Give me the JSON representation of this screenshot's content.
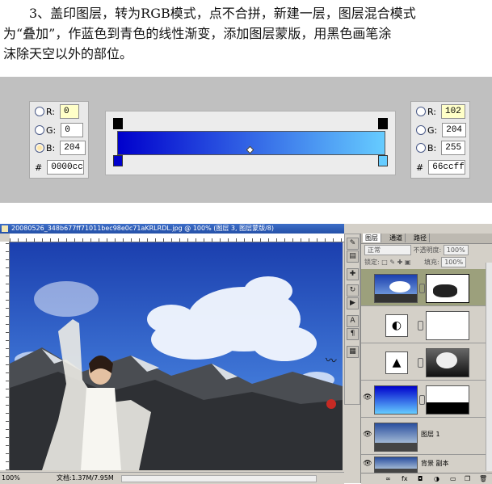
{
  "instructions": {
    "line1": "　　3、盖印图层，转为RGB模式，点不合拼，新建一层，图层混合模式",
    "line2": "为“叠加”，作蓝色到青色的线性渐变，添加图层蒙版，用黑色画笔涂",
    "line3": "沫除天空以外的部位。"
  },
  "left_color": {
    "r_label": "R:",
    "r_value": "0",
    "g_label": "G:",
    "g_value": "0",
    "b_label": "B:",
    "b_value": "204",
    "hex_label": "#",
    "hex_value": "0000cc",
    "color": "#0000cc"
  },
  "right_color": {
    "r_label": "R:",
    "r_value": "102",
    "g_label": "G:",
    "g_value": "204",
    "b_label": "B:",
    "b_value": "255",
    "hex_label": "#",
    "hex_value": "66ccff",
    "color": "#66ccff"
  },
  "document": {
    "title": "20080526_348b677ff71011bec98e0c71aKRLRDL.jpg @ 100% (图层 3, 图层蒙版/8)",
    "zoom": "100%",
    "doc_size": "文档:1.37M/7.95M"
  },
  "layers_panel": {
    "tabs": [
      "图层",
      "通道",
      "路径"
    ],
    "blend_mode": "正常",
    "opacity_label": "不透明度:",
    "opacity_value": "100%",
    "lock_label": "锁定:",
    "fill_label": "填充:",
    "fill_value": "100%",
    "layers": [
      {
        "name": "",
        "visible": false
      },
      {
        "name": "",
        "visible": false
      },
      {
        "name": "",
        "visible": false
      },
      {
        "name": "",
        "visible": true
      },
      {
        "name": "图层 1",
        "visible": true
      },
      {
        "name": "背景 副本",
        "visible": true
      }
    ],
    "bottom_icons": [
      "link-icon",
      "fx-icon",
      "mask-icon",
      "adjustment-icon",
      "folder-icon",
      "new-layer-icon",
      "trash-icon"
    ]
  },
  "colors": {
    "panel_bg": "#c0c0c0",
    "gradient_start": "#0000cc",
    "gradient_end": "#66ccff",
    "selected_layer": "#9ca07c"
  }
}
